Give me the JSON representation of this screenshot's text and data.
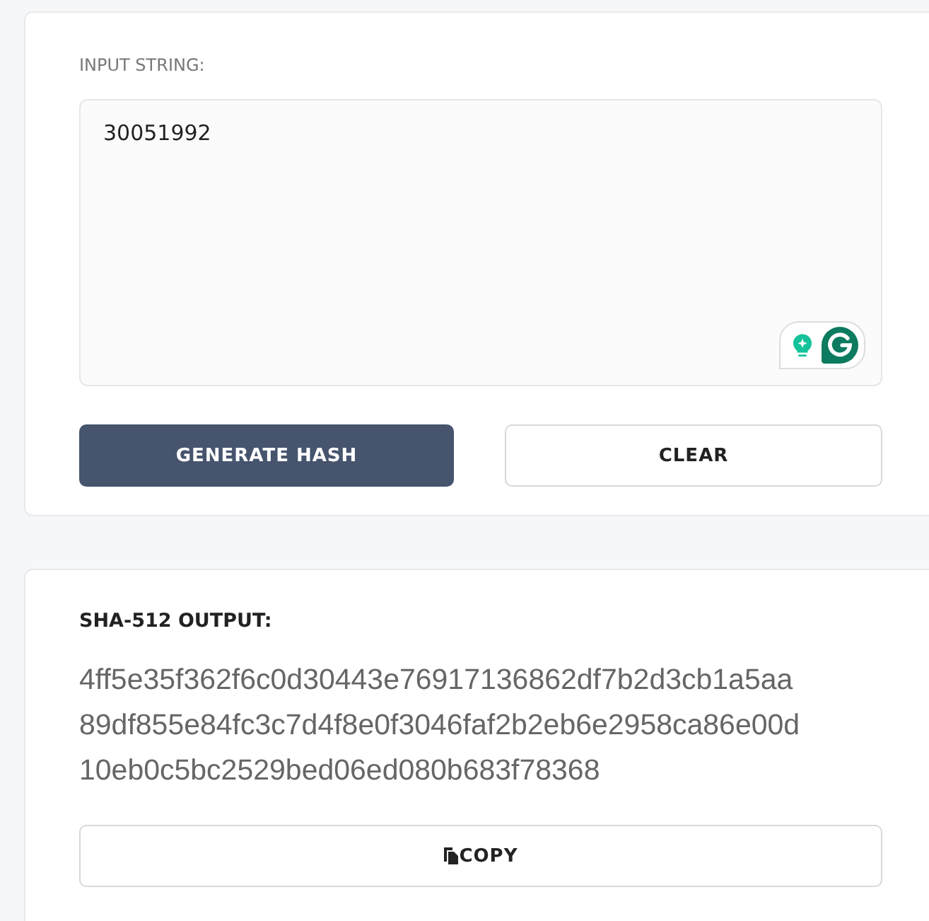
{
  "input_card": {
    "label": "INPUT STRING:",
    "input": {
      "value": "30051992"
    },
    "buttons": [
      {
        "label": "GENERATE HASH",
        "kind": "primary"
      },
      {
        "label": "CLEAR",
        "kind": "outline"
      }
    ]
  },
  "output_card": {
    "label": "SHA-512 OUTPUT:",
    "hash_lines": [
      "4ff5e35f362f6c0d30443e76917136862df7b2d3cb1a5aa",
      "89df855e84fc3c7d4f8e0f3046faf2b2eb6e2958ca86e00d",
      "10eb0c5bc2529bed06ed080b683f78368"
    ],
    "copy_button": {
      "label": "COPY"
    }
  }
}
